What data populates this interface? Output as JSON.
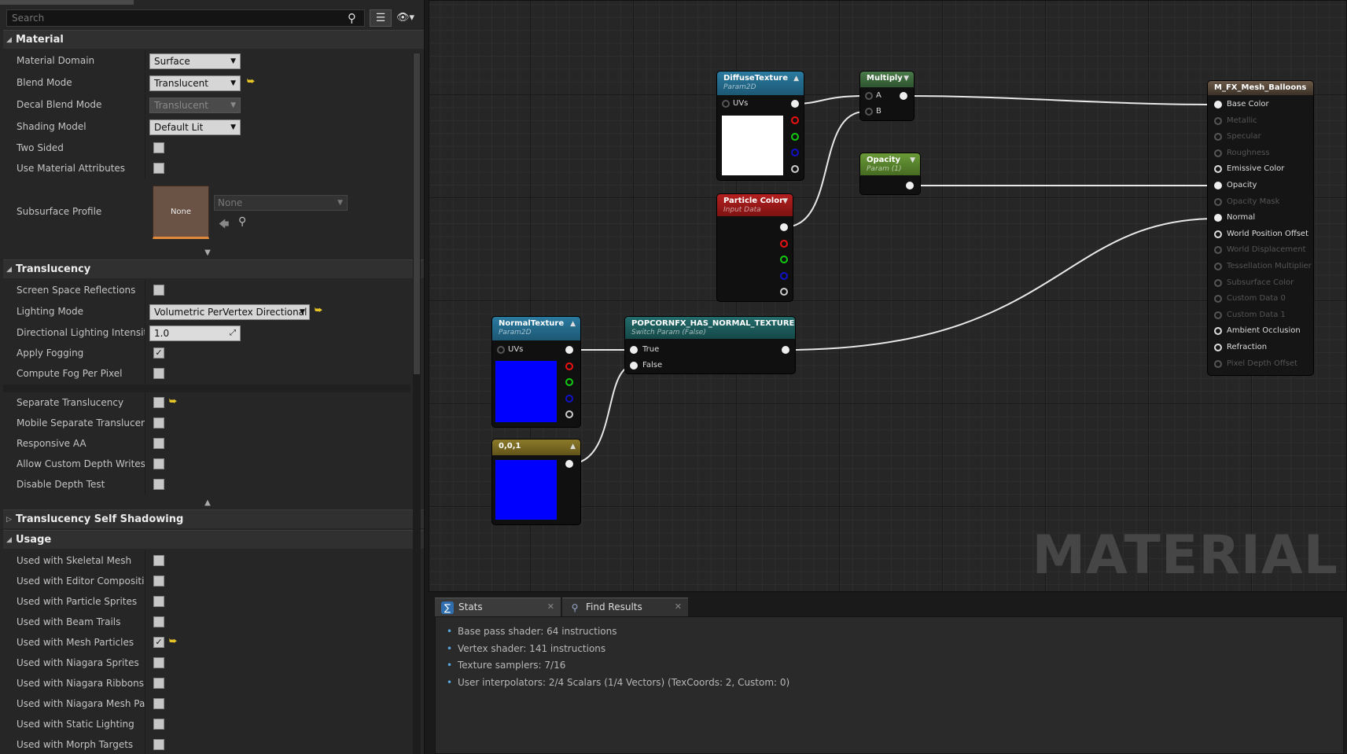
{
  "search": {
    "placeholder": "Search"
  },
  "categories": {
    "material": "Material",
    "translucency": "Translucency",
    "translucency_self_shadowing": "Translucency Self Shadowing",
    "usage": "Usage"
  },
  "material_props": {
    "material_domain": {
      "label": "Material Domain",
      "value": "Surface"
    },
    "blend_mode": {
      "label": "Blend Mode",
      "value": "Translucent"
    },
    "decal_blend_mode": {
      "label": "Decal Blend Mode",
      "value": "Translucent"
    },
    "shading_model": {
      "label": "Shading Model",
      "value": "Default Lit"
    },
    "two_sided": {
      "label": "Two Sided",
      "checked": false
    },
    "use_material_attributes": {
      "label": "Use Material Attributes",
      "checked": false
    },
    "subsurface_profile": {
      "label": "Subsurface Profile",
      "thumb": "None",
      "value": "None"
    }
  },
  "translucency_props": {
    "ssr": {
      "label": "Screen Space Reflections",
      "checked": false
    },
    "lighting_mode": {
      "label": "Lighting Mode",
      "value": "Volumetric PerVertex Directional"
    },
    "dir_intensity": {
      "label": "Directional Lighting Intensity",
      "value": "1.0"
    },
    "apply_fogging": {
      "label": "Apply Fogging",
      "checked": true
    },
    "fog_per_pixel": {
      "label": "Compute Fog Per Pixel",
      "checked": false
    },
    "separate_translucency": {
      "label": "Separate Translucency",
      "checked": false
    },
    "mobile_separate": {
      "label": "Mobile Separate Translucency",
      "checked": false
    },
    "responsive_aa": {
      "label": "Responsive AA",
      "checked": false
    },
    "custom_depth_writes": {
      "label": "Allow Custom Depth Writes",
      "checked": false
    },
    "disable_depth_test": {
      "label": "Disable Depth Test",
      "checked": false
    }
  },
  "usage_props": [
    {
      "label": "Used with Skeletal Mesh",
      "checked": false
    },
    {
      "label": "Used with Editor Compositing",
      "checked": false
    },
    {
      "label": "Used with Particle Sprites",
      "checked": false
    },
    {
      "label": "Used with Beam Trails",
      "checked": false
    },
    {
      "label": "Used with Mesh Particles",
      "checked": true
    },
    {
      "label": "Used with Niagara Sprites",
      "checked": false
    },
    {
      "label": "Used with Niagara Ribbons",
      "checked": false
    },
    {
      "label": "Used with Niagara Mesh Particles",
      "checked": false
    },
    {
      "label": "Used with Static Lighting",
      "checked": false
    },
    {
      "label": "Used with Morph Targets",
      "checked": false
    }
  ],
  "nodes": {
    "diffuse": {
      "title": "DiffuseTexture",
      "subtitle": "Param2D",
      "uvs": "UVs",
      "color": "#246a8c",
      "preview": "#ffffff"
    },
    "multiply": {
      "title": "Multiply",
      "a": "A",
      "b": "B",
      "color": "#3d6e3d"
    },
    "opacity": {
      "title": "Opacity",
      "subtitle": "Param (1)",
      "color": "#5c8c2a"
    },
    "particle": {
      "title": "Particle Color",
      "subtitle": "Input Data",
      "color": "#9b1a1a"
    },
    "normal": {
      "title": "NormalTexture",
      "subtitle": "Param2D",
      "uvs": "UVs",
      "color": "#246a8c",
      "preview": "#0000ff"
    },
    "switch": {
      "title": "POPCORNFX_HAS_NORMAL_TEXTURE",
      "subtitle": "Switch Param (False)",
      "true": "True",
      "false": "False",
      "color": "#1d5a5a"
    },
    "constant": {
      "title": "0,0,1",
      "color": "#7d6a1e",
      "preview": "#0000ff"
    },
    "result": {
      "title": "M_FX_Mesh_Balloons",
      "color": "#5a4a3a",
      "inputs": [
        {
          "label": "Base Color",
          "active": true
        },
        {
          "label": "Metallic",
          "active": false
        },
        {
          "label": "Specular",
          "active": false
        },
        {
          "label": "Roughness",
          "active": false
        },
        {
          "label": "Emissive Color",
          "active": true
        },
        {
          "label": "Opacity",
          "active": true
        },
        {
          "label": "Opacity Mask",
          "active": false
        },
        {
          "label": "Normal",
          "active": true
        },
        {
          "label": "World Position Offset",
          "active": true
        },
        {
          "label": "World Displacement",
          "active": false
        },
        {
          "label": "Tessellation Multiplier",
          "active": false
        },
        {
          "label": "Subsurface Color",
          "active": false
        },
        {
          "label": "Custom Data 0",
          "active": false
        },
        {
          "label": "Custom Data 1",
          "active": false
        },
        {
          "label": "Ambient Occlusion",
          "active": true
        },
        {
          "label": "Refraction",
          "active": true
        },
        {
          "label": "Pixel Depth Offset",
          "active": false
        }
      ]
    }
  },
  "watermark": "MATERIAL",
  "tabs": [
    {
      "label": "Stats",
      "icon": "stats-icon"
    },
    {
      "label": "Find Results",
      "icon": "find-results-icon"
    }
  ],
  "stats": [
    "Base pass shader: 64 instructions",
    "Vertex shader: 141 instructions",
    "Texture samplers: 7/16",
    "User interpolators: 2/4 Scalars (1/4 Vectors) (TexCoords: 2, Custom: 0)"
  ]
}
